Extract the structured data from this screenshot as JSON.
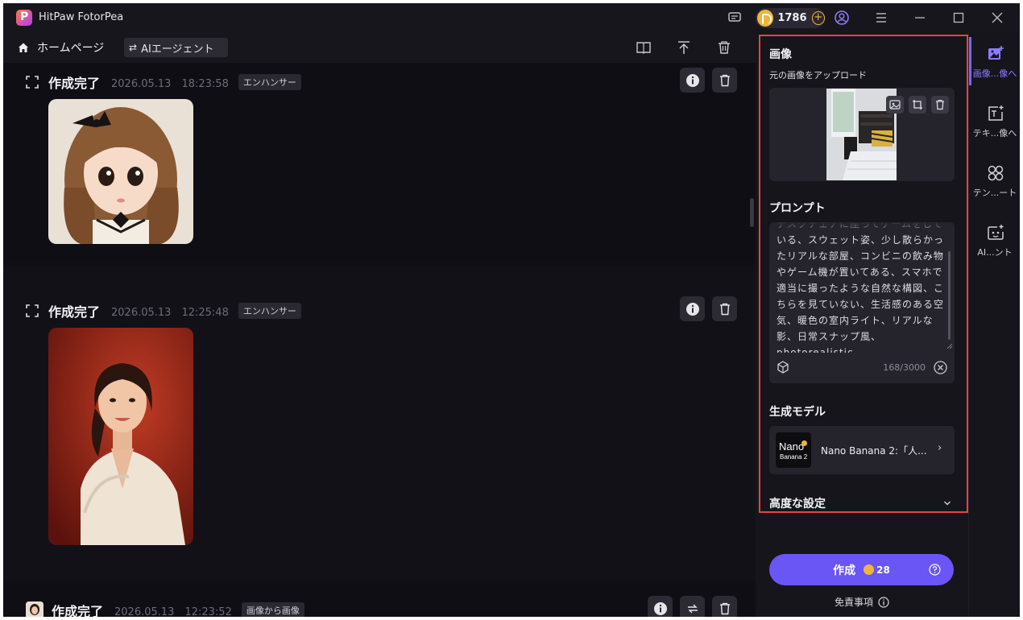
{
  "app": {
    "title": "HitPaw FotorPea",
    "credits": "1786"
  },
  "nav": {
    "home": "ホームページ",
    "agent": "AIエージェント"
  },
  "cards": [
    {
      "status": "作成完了",
      "time": "2026.05.13　18:23:58",
      "tag": "エンハンサー"
    },
    {
      "status": "作成完了",
      "time": "2026.05.13　12:25:48",
      "tag": "エンハンサー"
    },
    {
      "status": "作成完了",
      "time": "2026.05.13　12:23:52",
      "tag": "画像から画像"
    }
  ],
  "panel": {
    "image_title": "画像",
    "image_sub": "元の画像をアップロード",
    "prompt_title": "プロンプト",
    "prompt_text": "デスクチェアに座ってゲームをしている、スウェット姿、少し散らかったリアルな部屋、コンビニの飲み物やゲーム機が置いてある、スマホで適当に撮ったような自然な構図、こちらを見ていない、生活感のある空気、暖色の室内ライト、リアルな影、日常スナップ風、photorealistic",
    "prompt_count": "168/3000",
    "model_title": "生成モデル",
    "model_name": "Nano Banana 2:「人...",
    "model_logo_top": "Nano",
    "model_logo_bottom": "Banana 2",
    "advanced": "高度な設定",
    "generate": "作成",
    "cost": "28",
    "disclaimer": "免責事項"
  },
  "sidebar": [
    {
      "label": "画像...像へ",
      "icon": "image-plus-icon",
      "active": true
    },
    {
      "label": "テキ...像へ",
      "icon": "text-image-icon",
      "active": false
    },
    {
      "label": "テン...ート",
      "icon": "template-icon",
      "active": false
    },
    {
      "label": "AI...ント",
      "icon": "ai-agent-icon",
      "active": false
    }
  ],
  "colors": {
    "accent": "#6a55f5",
    "highlight_frame": "#e8453c",
    "coin": "#f0b43a"
  }
}
